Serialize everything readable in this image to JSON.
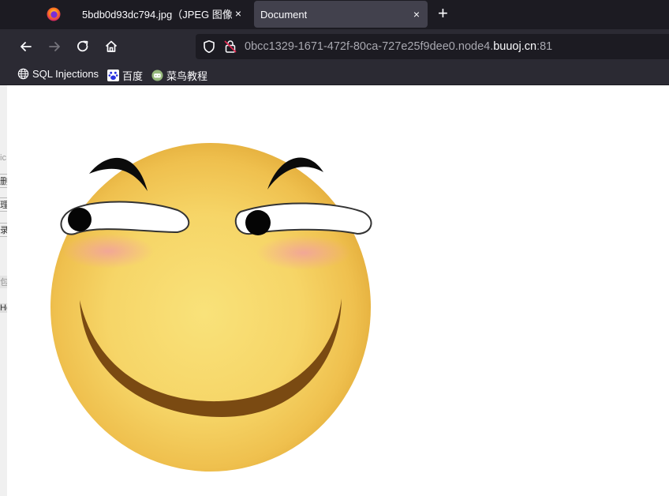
{
  "tabs": [
    {
      "label": "5bdb0d93dc794.jpg（JPEG 图像，",
      "close": "×"
    },
    {
      "label": "Document",
      "close": "×"
    }
  ],
  "new_tab_symbol": "+",
  "url": {
    "prefix": "0bcc1329-1671-472f-80ca-727e25f9dee0.node4.",
    "host": "buuoj.cn",
    "port": ":81"
  },
  "bookmarks": [
    {
      "label": "SQL Injections",
      "icon": "globe-icon"
    },
    {
      "label": "百度",
      "icon": "baidu-paw-icon"
    },
    {
      "label": "菜鸟教程",
      "icon": "runoob-icon"
    }
  ],
  "left_strip_glyphs": [
    "ic",
    "删",
    "理",
    "录",
    "包",
    "He"
  ],
  "colors": {
    "tabbar": "#1c1b22",
    "navbar": "#2b2a33",
    "active_tab": "#42414d",
    "face": "#f6d567",
    "mouth": "#7a4a12"
  }
}
